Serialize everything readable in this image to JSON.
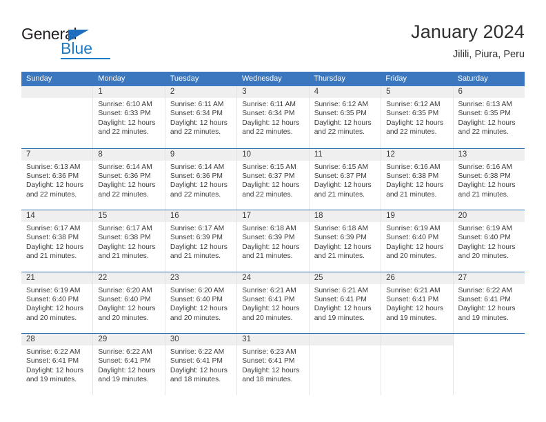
{
  "brand": {
    "name_dark": "General",
    "name_blue": "Blue",
    "triangle_icon": "brand-triangle-icon",
    "accent_color": "#1f7ac4"
  },
  "header": {
    "title": "January 2024",
    "location": "Jilili, Piura, Peru"
  },
  "theme": {
    "header_blue": "#3b77be",
    "week_divider_blue": "#2e6dab",
    "daynum_band_gray": "#efeff0",
    "text_color": "#3a3a3a"
  },
  "calendar": {
    "weekdays": [
      "Sunday",
      "Monday",
      "Tuesday",
      "Wednesday",
      "Thursday",
      "Friday",
      "Saturday"
    ],
    "weeks": [
      [
        {
          "day": ""
        },
        {
          "day": "1",
          "sunrise": "Sunrise: 6:10 AM",
          "sunset": "Sunset: 6:33 PM",
          "daylight_1": "Daylight: 12 hours",
          "daylight_2": "and 22 minutes."
        },
        {
          "day": "2",
          "sunrise": "Sunrise: 6:11 AM",
          "sunset": "Sunset: 6:34 PM",
          "daylight_1": "Daylight: 12 hours",
          "daylight_2": "and 22 minutes."
        },
        {
          "day": "3",
          "sunrise": "Sunrise: 6:11 AM",
          "sunset": "Sunset: 6:34 PM",
          "daylight_1": "Daylight: 12 hours",
          "daylight_2": "and 22 minutes."
        },
        {
          "day": "4",
          "sunrise": "Sunrise: 6:12 AM",
          "sunset": "Sunset: 6:35 PM",
          "daylight_1": "Daylight: 12 hours",
          "daylight_2": "and 22 minutes."
        },
        {
          "day": "5",
          "sunrise": "Sunrise: 6:12 AM",
          "sunset": "Sunset: 6:35 PM",
          "daylight_1": "Daylight: 12 hours",
          "daylight_2": "and 22 minutes."
        },
        {
          "day": "6",
          "sunrise": "Sunrise: 6:13 AM",
          "sunset": "Sunset: 6:35 PM",
          "daylight_1": "Daylight: 12 hours",
          "daylight_2": "and 22 minutes."
        }
      ],
      [
        {
          "day": "7",
          "sunrise": "Sunrise: 6:13 AM",
          "sunset": "Sunset: 6:36 PM",
          "daylight_1": "Daylight: 12 hours",
          "daylight_2": "and 22 minutes."
        },
        {
          "day": "8",
          "sunrise": "Sunrise: 6:14 AM",
          "sunset": "Sunset: 6:36 PM",
          "daylight_1": "Daylight: 12 hours",
          "daylight_2": "and 22 minutes."
        },
        {
          "day": "9",
          "sunrise": "Sunrise: 6:14 AM",
          "sunset": "Sunset: 6:36 PM",
          "daylight_1": "Daylight: 12 hours",
          "daylight_2": "and 22 minutes."
        },
        {
          "day": "10",
          "sunrise": "Sunrise: 6:15 AM",
          "sunset": "Sunset: 6:37 PM",
          "daylight_1": "Daylight: 12 hours",
          "daylight_2": "and 22 minutes."
        },
        {
          "day": "11",
          "sunrise": "Sunrise: 6:15 AM",
          "sunset": "Sunset: 6:37 PM",
          "daylight_1": "Daylight: 12 hours",
          "daylight_2": "and 21 minutes."
        },
        {
          "day": "12",
          "sunrise": "Sunrise: 6:16 AM",
          "sunset": "Sunset: 6:38 PM",
          "daylight_1": "Daylight: 12 hours",
          "daylight_2": "and 21 minutes."
        },
        {
          "day": "13",
          "sunrise": "Sunrise: 6:16 AM",
          "sunset": "Sunset: 6:38 PM",
          "daylight_1": "Daylight: 12 hours",
          "daylight_2": "and 21 minutes."
        }
      ],
      [
        {
          "day": "14",
          "sunrise": "Sunrise: 6:17 AM",
          "sunset": "Sunset: 6:38 PM",
          "daylight_1": "Daylight: 12 hours",
          "daylight_2": "and 21 minutes."
        },
        {
          "day": "15",
          "sunrise": "Sunrise: 6:17 AM",
          "sunset": "Sunset: 6:38 PM",
          "daylight_1": "Daylight: 12 hours",
          "daylight_2": "and 21 minutes."
        },
        {
          "day": "16",
          "sunrise": "Sunrise: 6:17 AM",
          "sunset": "Sunset: 6:39 PM",
          "daylight_1": "Daylight: 12 hours",
          "daylight_2": "and 21 minutes."
        },
        {
          "day": "17",
          "sunrise": "Sunrise: 6:18 AM",
          "sunset": "Sunset: 6:39 PM",
          "daylight_1": "Daylight: 12 hours",
          "daylight_2": "and 21 minutes."
        },
        {
          "day": "18",
          "sunrise": "Sunrise: 6:18 AM",
          "sunset": "Sunset: 6:39 PM",
          "daylight_1": "Daylight: 12 hours",
          "daylight_2": "and 21 minutes."
        },
        {
          "day": "19",
          "sunrise": "Sunrise: 6:19 AM",
          "sunset": "Sunset: 6:40 PM",
          "daylight_1": "Daylight: 12 hours",
          "daylight_2": "and 20 minutes."
        },
        {
          "day": "20",
          "sunrise": "Sunrise: 6:19 AM",
          "sunset": "Sunset: 6:40 PM",
          "daylight_1": "Daylight: 12 hours",
          "daylight_2": "and 20 minutes."
        }
      ],
      [
        {
          "day": "21",
          "sunrise": "Sunrise: 6:19 AM",
          "sunset": "Sunset: 6:40 PM",
          "daylight_1": "Daylight: 12 hours",
          "daylight_2": "and 20 minutes."
        },
        {
          "day": "22",
          "sunrise": "Sunrise: 6:20 AM",
          "sunset": "Sunset: 6:40 PM",
          "daylight_1": "Daylight: 12 hours",
          "daylight_2": "and 20 minutes."
        },
        {
          "day": "23",
          "sunrise": "Sunrise: 6:20 AM",
          "sunset": "Sunset: 6:40 PM",
          "daylight_1": "Daylight: 12 hours",
          "daylight_2": "and 20 minutes."
        },
        {
          "day": "24",
          "sunrise": "Sunrise: 6:21 AM",
          "sunset": "Sunset: 6:41 PM",
          "daylight_1": "Daylight: 12 hours",
          "daylight_2": "and 20 minutes."
        },
        {
          "day": "25",
          "sunrise": "Sunrise: 6:21 AM",
          "sunset": "Sunset: 6:41 PM",
          "daylight_1": "Daylight: 12 hours",
          "daylight_2": "and 19 minutes."
        },
        {
          "day": "26",
          "sunrise": "Sunrise: 6:21 AM",
          "sunset": "Sunset: 6:41 PM",
          "daylight_1": "Daylight: 12 hours",
          "daylight_2": "and 19 minutes."
        },
        {
          "day": "27",
          "sunrise": "Sunrise: 6:22 AM",
          "sunset": "Sunset: 6:41 PM",
          "daylight_1": "Daylight: 12 hours",
          "daylight_2": "and 19 minutes."
        }
      ],
      [
        {
          "day": "28",
          "sunrise": "Sunrise: 6:22 AM",
          "sunset": "Sunset: 6:41 PM",
          "daylight_1": "Daylight: 12 hours",
          "daylight_2": "and 19 minutes."
        },
        {
          "day": "29",
          "sunrise": "Sunrise: 6:22 AM",
          "sunset": "Sunset: 6:41 PM",
          "daylight_1": "Daylight: 12 hours",
          "daylight_2": "and 19 minutes."
        },
        {
          "day": "30",
          "sunrise": "Sunrise: 6:22 AM",
          "sunset": "Sunset: 6:41 PM",
          "daylight_1": "Daylight: 12 hours",
          "daylight_2": "and 18 minutes."
        },
        {
          "day": "31",
          "sunrise": "Sunrise: 6:23 AM",
          "sunset": "Sunset: 6:41 PM",
          "daylight_1": "Daylight: 12 hours",
          "daylight_2": "and 18 minutes."
        },
        {
          "day": ""
        },
        {
          "day": ""
        },
        {
          "day": "",
          "no_band": true
        }
      ]
    ]
  }
}
